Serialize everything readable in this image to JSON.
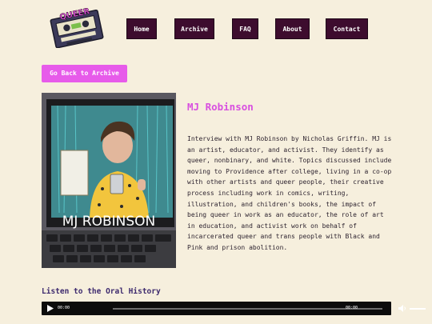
{
  "logo": {
    "alt": "Queer Oral History"
  },
  "nav": {
    "items": [
      {
        "label": "Home"
      },
      {
        "label": "Archive"
      },
      {
        "label": "FAQ"
      },
      {
        "label": "About"
      },
      {
        "label": "Contact"
      }
    ]
  },
  "back_button": {
    "label": "Go Back to Archive"
  },
  "interview": {
    "name": "MJ Robinson",
    "photo_caption": "MJ ROBINSON",
    "description": "Interview with MJ Robinson by Nicholas Griffin. MJ is an artist, educator, and activist. They identify as queer, nonbinary, and white. Topics discussed include moving to Providence after college, living in a co-op with other artists and queer people, their creative process including work in comics, writing, illustration, and children's books, the impact of being queer in work as an educator, the role of art in education, and activist work on behalf of incarcerated queer and trans people with Black and Pink and prison abolition."
  },
  "audio": {
    "heading": "Listen to the Oral History",
    "current_time": "00:00",
    "duration": "00:00",
    "progress": 0,
    "volume": 1
  },
  "colors": {
    "background": "#f6efdd",
    "nav_button": "#3d0c2e",
    "accent_pink": "#e75bea",
    "title_pink": "#d84fe0",
    "heading_purple": "#3d2a6e"
  }
}
